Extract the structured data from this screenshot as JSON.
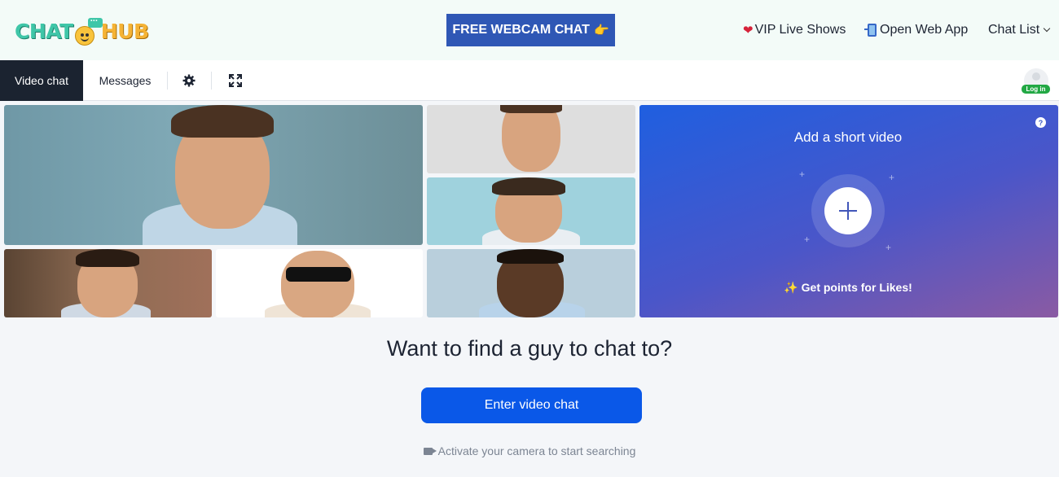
{
  "header": {
    "logo_left": "CHAT",
    "logo_right": "HUB",
    "cta_label": "FREE WEBCAM CHAT",
    "cta_emoji": "👉",
    "links": [
      {
        "icon": "heart",
        "label": "VIP Live Shows"
      },
      {
        "icon": "phone",
        "label": "Open Web App"
      },
      {
        "icon": "chevron-down",
        "label": "Chat List"
      }
    ]
  },
  "tabs": {
    "video_chat": "Video chat",
    "messages": "Messages",
    "login_badge": "Log in"
  },
  "promo": {
    "title": "Add a short video",
    "help": "?",
    "points": "Get points for Likes!"
  },
  "main": {
    "headline": "Want to find a guy to chat to?",
    "button": "Enter video chat",
    "hint": "Activate your camera to start searching"
  },
  "colors": {
    "accent": "#0a58e8",
    "header_cta": "#2f57b5",
    "active_tab": "#1b2330",
    "login_badge": "#22a844"
  }
}
